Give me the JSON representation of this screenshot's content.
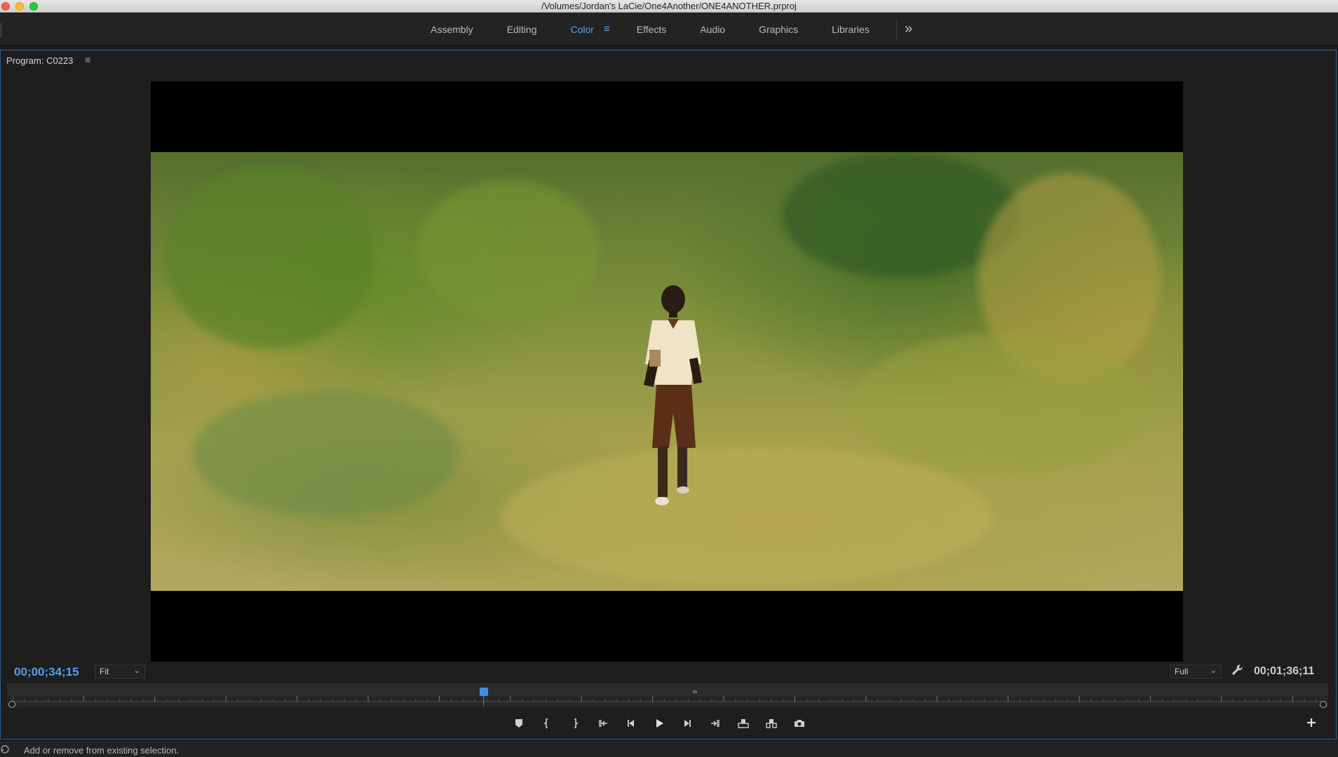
{
  "window": {
    "title": "/Volumes/Jordan's LaCie/One4Another/ONE4ANOTHER.prproj"
  },
  "workspaces": {
    "tabs": [
      {
        "label": "Assembly"
      },
      {
        "label": "Editing"
      },
      {
        "label": "Color",
        "active": true
      },
      {
        "label": "Effects"
      },
      {
        "label": "Audio"
      },
      {
        "label": "Graphics"
      },
      {
        "label": "Libraries"
      }
    ],
    "overflow_icon": "double-chevron-right-icon"
  },
  "program_monitor": {
    "title": "Program: C0223",
    "current_timecode": "00;00;34;15",
    "zoom_select": "Fit",
    "resolution_select": "Full",
    "duration_timecode": "00;01;36;11",
    "playhead_fraction": 0.36
  },
  "transport": {
    "buttons": [
      {
        "name": "add-marker-icon"
      },
      {
        "name": "mark-in-icon"
      },
      {
        "name": "mark-out-icon"
      },
      {
        "name": "go-to-in-icon"
      },
      {
        "name": "step-back-icon"
      },
      {
        "name": "play-icon"
      },
      {
        "name": "step-forward-icon"
      },
      {
        "name": "go-to-out-icon"
      },
      {
        "name": "lift-icon"
      },
      {
        "name": "extract-icon"
      },
      {
        "name": "export-frame-icon"
      }
    ]
  },
  "status": {
    "text": "Add or remove from existing selection."
  },
  "colors": {
    "accent": "#4da3f0",
    "panel_border": "#2a5f95",
    "background": "#1d1d1d"
  }
}
